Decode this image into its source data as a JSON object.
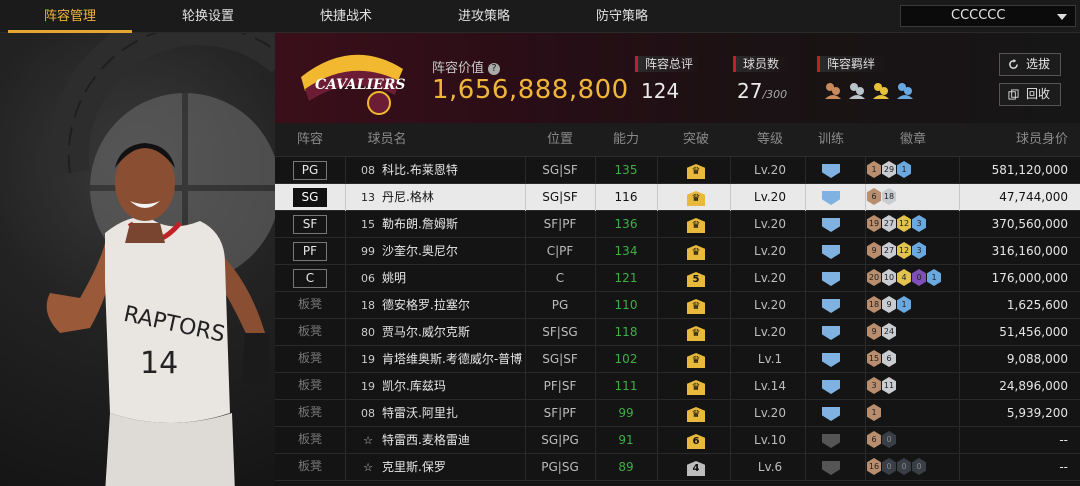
{
  "nav": {
    "tabs": [
      "阵容管理",
      "轮换设置",
      "快捷战术",
      "进攻策略",
      "防守策略"
    ],
    "active": 0
  },
  "select": {
    "value": "CCCCCC"
  },
  "team": {
    "logo_text": "CAVALIERS",
    "value_label": "阵容价值",
    "value": "1,656,888,800"
  },
  "stats": {
    "rating_label": "阵容总评",
    "rating": "124",
    "players_label": "球员数",
    "players": "27",
    "players_max": "/300",
    "synergy_label": "阵容羁绊"
  },
  "buttons": {
    "pick": "选拔",
    "recycle": "回收"
  },
  "columns": [
    "阵容",
    "球员名",
    "位置",
    "能力",
    "突破",
    "等级",
    "训练",
    "徽章",
    "球员身价"
  ],
  "colors": {
    "accent": "#f0b63a",
    "power": "#3fae46",
    "selected_row": "#e9e9e9"
  },
  "rows": [
    {
      "slot": "PG",
      "num": "08",
      "name": "科比.布莱恩特",
      "pos": "SG|SF",
      "power": "135",
      "brk": "crown",
      "level": "Lv.20",
      "train": "blue",
      "badges": [
        [
          "bronze",
          "1"
        ],
        [
          "silver",
          "29"
        ],
        [
          "blue",
          "1"
        ]
      ],
      "salary": "581,120,000"
    },
    {
      "slot": "SG",
      "num": "13",
      "name": "丹尼.格林",
      "pos": "SG|SF",
      "power": "116",
      "brk": "crown",
      "level": "Lv.20",
      "train": "blue",
      "badges": [
        [
          "bronze",
          "6"
        ],
        [
          "silver",
          "18"
        ]
      ],
      "salary": "47,744,000",
      "selected": true
    },
    {
      "slot": "SF",
      "num": "15",
      "name": "勒布朗.詹姆斯",
      "pos": "SF|PF",
      "power": "136",
      "brk": "crown",
      "level": "Lv.20",
      "train": "blue",
      "badges": [
        [
          "bronze",
          "19"
        ],
        [
          "silver",
          "27"
        ],
        [
          "gold",
          "12"
        ],
        [
          "blue",
          "3"
        ]
      ],
      "salary": "370,560,000"
    },
    {
      "slot": "PF",
      "num": "99",
      "name": "沙奎尔.奥尼尔",
      "pos": "C|PF",
      "power": "134",
      "brk": "crown",
      "level": "Lv.20",
      "train": "blue",
      "badges": [
        [
          "bronze",
          "9"
        ],
        [
          "silver",
          "27"
        ],
        [
          "gold",
          "12"
        ],
        [
          "blue",
          "3"
        ]
      ],
      "salary": "316,160,000"
    },
    {
      "slot": "C",
      "num": "06",
      "name": "姚明",
      "pos": "C",
      "power": "121",
      "brk": "5",
      "level": "Lv.20",
      "train": "blue",
      "badges": [
        [
          "bronze",
          "20"
        ],
        [
          "silver",
          "10"
        ],
        [
          "gold",
          "4"
        ],
        [
          "purple",
          "0"
        ],
        [
          "blue",
          "1"
        ]
      ],
      "salary": "176,000,000"
    },
    {
      "slot": "板凳",
      "num": "18",
      "name": "德安格罗.拉塞尔",
      "pos": "PG",
      "power": "110",
      "brk": "crown",
      "level": "Lv.20",
      "train": "blue",
      "badges": [
        [
          "bronze",
          "18"
        ],
        [
          "silver",
          "9"
        ],
        [
          "blue",
          "1"
        ]
      ],
      "salary": "1,625,600"
    },
    {
      "slot": "板凳",
      "num": "80",
      "name": "贾马尔.威尔克斯",
      "pos": "SF|SG",
      "power": "118",
      "brk": "crown",
      "level": "Lv.20",
      "train": "blue",
      "badges": [
        [
          "bronze",
          "9"
        ],
        [
          "silver",
          "24"
        ]
      ],
      "salary": "51,456,000"
    },
    {
      "slot": "板凳",
      "num": "19",
      "name": "肯塔维奥斯.考德威尔-普博",
      "pos": "SG|SF",
      "power": "102",
      "brk": "crown",
      "level": "Lv.1",
      "train": "blue",
      "badges": [
        [
          "bronze",
          "15"
        ],
        [
          "silver",
          "6"
        ]
      ],
      "salary": "9,088,000"
    },
    {
      "slot": "板凳",
      "num": "19",
      "name": "凯尔.库兹玛",
      "pos": "PF|SF",
      "power": "111",
      "brk": "crown",
      "level": "Lv.14",
      "train": "blue",
      "badges": [
        [
          "bronze",
          "3"
        ],
        [
          "silver",
          "11"
        ]
      ],
      "salary": "24,896,000"
    },
    {
      "slot": "板凳",
      "num": "08",
      "name": "特雷沃.阿里扎",
      "pos": "SF|PF",
      "power": "99",
      "brk": "crown",
      "level": "Lv.20",
      "train": "blue",
      "badges": [
        [
          "bronze",
          "1"
        ]
      ],
      "salary": "5,939,200"
    },
    {
      "slot": "板凳",
      "num": "☆",
      "name": "特雷西.麦格雷迪",
      "pos": "SG|PG",
      "power": "91",
      "brk": "6",
      "level": "Lv.10",
      "train": "gray",
      "badges": [
        [
          "bronze",
          "6"
        ],
        [
          "dark",
          "0"
        ]
      ],
      "salary": "--"
    },
    {
      "slot": "板凳",
      "num": "☆",
      "name": "克里斯.保罗",
      "pos": "PG|SG",
      "power": "89",
      "brk": "4g",
      "level": "Lv.6",
      "train": "gray",
      "badges": [
        [
          "bronze",
          "16"
        ],
        [
          "dark",
          "0"
        ],
        [
          "dark",
          "0"
        ],
        [
          "dark",
          "0"
        ]
      ],
      "salary": "--"
    }
  ]
}
